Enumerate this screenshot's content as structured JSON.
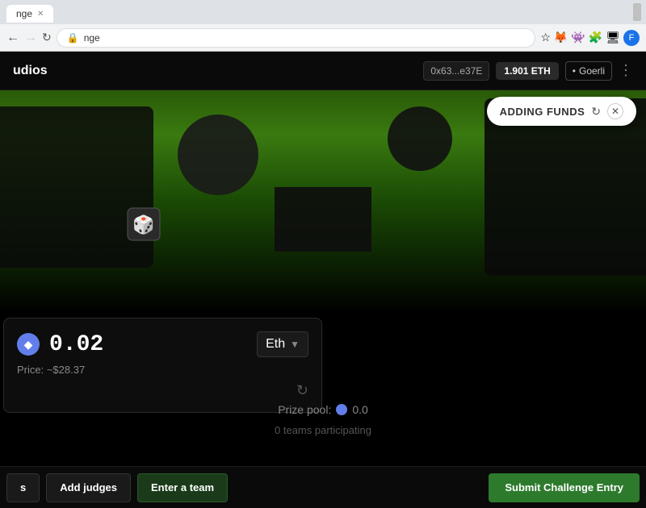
{
  "browser": {
    "tab_title": "nge",
    "icons": {
      "zoom": "⊖",
      "star": "☆",
      "metamask": "🦊",
      "avatar_label": "F"
    }
  },
  "header": {
    "title": "udios",
    "wallet_address": "0x63...e37E",
    "eth_balance": "1.901 ETH",
    "network": "• Goerli",
    "menu": "⋮"
  },
  "adding_funds": {
    "label": "ADDING FUNDS",
    "close": "✕"
  },
  "fund_card": {
    "amount": "0.02",
    "currency": "Eth",
    "price_label": "Price: ~$28.37"
  },
  "prize_pool": {
    "label": "Prize pool:",
    "value": "0.0"
  },
  "teams": {
    "count_label": "0 teams participating"
  },
  "buttons": {
    "details": "s",
    "add_judges": "Add judges",
    "enter_team": "Enter a team",
    "submit": "Submit Challenge Entry"
  }
}
